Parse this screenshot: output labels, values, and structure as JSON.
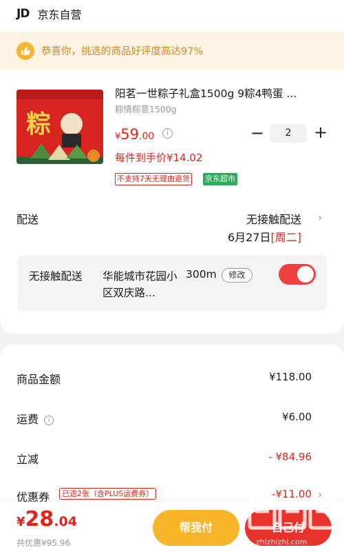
{
  "header": {
    "logo": "JD",
    "shop_name": "京东自营"
  },
  "notice": {
    "icon": "thumbs-up-icon",
    "text": "恭喜你，挑选的商品好评度高达97%"
  },
  "product": {
    "title": "阳茗一世粽子礼盒1500g 9粽4鸭蛋 ...",
    "spec": "粽情粽意1500g",
    "price_symbol": "¥",
    "price_int": "59",
    "price_dec": ".00",
    "quantity": "2",
    "unit_price": "每件到手价¥14.02",
    "tag_no_return": "不支持7天无理由退货",
    "tag_supermarket": "京东超市",
    "image_char": "粽"
  },
  "delivery": {
    "label": "配送",
    "method": "无接触配送",
    "date": "6月27日",
    "weekday": "[周二]"
  },
  "contactless": {
    "label": "无接触配送",
    "address": "华能城市花园小区双庆路...",
    "distance": "300m",
    "edit_label": "修改",
    "enabled": true
  },
  "summary": {
    "goods_label": "商品金额",
    "goods_value": "¥118.00",
    "shipping_label": "运费",
    "shipping_value": "¥6.00",
    "discount_label": "立减",
    "discount_value": "- ¥84.96",
    "coupon_label": "优惠券",
    "coupon_tag": "已选2张（含PLUS运费券）",
    "coupon_value": "-¥11.00"
  },
  "bottom": {
    "total_symbol": "¥",
    "total_int": "28",
    "total_dec": ".04",
    "saved": "共优惠¥95.96",
    "help_pay": "帮我付",
    "self_pay": "自己付"
  },
  "watermark": {
    "text": "zhizhizhi.com"
  },
  "colors": {
    "accent_red": "#e2231a",
    "pay_orange": "#f7b52c",
    "notice_bg": "#fdf4e3",
    "tag_green": "#2faa5a"
  }
}
